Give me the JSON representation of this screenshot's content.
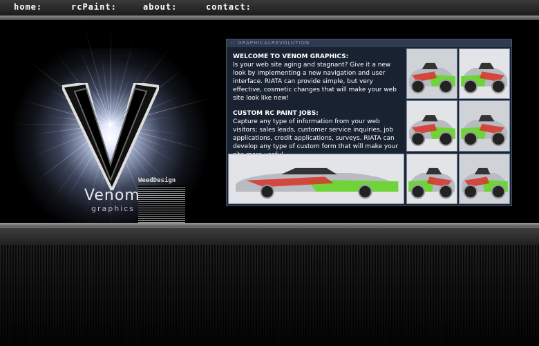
{
  "nav": {
    "items": [
      "home:",
      "rcPaint:",
      "about:",
      "contact:"
    ]
  },
  "logo": {
    "brand": "Venom",
    "sub": "graphics",
    "weed_title": "WeedDesign"
  },
  "panel": {
    "title": ":: GRAPHICALREVOLUTION",
    "section1_heading": "WELCOME TO VENOM GRAPHICS:",
    "section1_body": "Is your web site aging and stagnant? Give it a new look by implementing a new navigation and user interface. RIATA can provide simple, but very effective, cosmetic changes that will make your web site look like new!",
    "section2_heading": "CUSTOM RC PAINT JOBS:",
    "section2_body": "Capture any type of information from your web visitors; sales leads, customer service inquiries, job applications, credit applications, surveys. RIATA can develop any type of custom form that will make your site more useful."
  },
  "colors": {
    "panel_bg": "#1b2433",
    "car_red": "#d8322a",
    "car_green": "#6fd43a",
    "car_silver": "#b8bcc2"
  },
  "thumbnails": {
    "count": 7,
    "icon": "rc-car-photo"
  }
}
